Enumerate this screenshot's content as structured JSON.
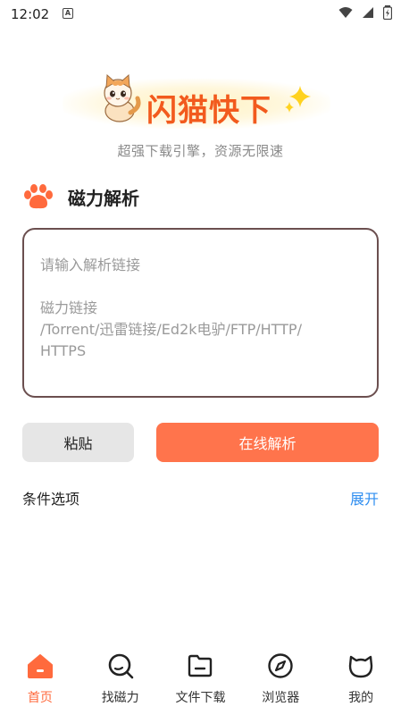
{
  "status_bar": {
    "time": "12:02",
    "notification_letter": "A"
  },
  "app": {
    "logo_title": "闪猫快下",
    "tagline": "超强下载引擎，资源无限速"
  },
  "section": {
    "title": "磁力解析"
  },
  "input": {
    "placeholder": "请输入解析链接",
    "hint_line1": "磁力链接",
    "hint_line2": "/Torrent/迅雷链接/Ed2k电驴/FTP/HTTP/",
    "hint_line3": "HTTPS"
  },
  "actions": {
    "paste_label": "粘贴",
    "parse_label": "在线解析"
  },
  "options": {
    "label": "条件选项",
    "expand_label": "展开"
  },
  "nav": {
    "items": [
      {
        "label": "首页",
        "icon": "home-icon",
        "active": true
      },
      {
        "label": "找磁力",
        "icon": "search-icon",
        "active": false
      },
      {
        "label": "文件下载",
        "icon": "folder-icon",
        "active": false
      },
      {
        "label": "浏览器",
        "icon": "compass-icon",
        "active": false
      },
      {
        "label": "我的",
        "icon": "cat-face-icon",
        "active": false
      }
    ]
  },
  "colors": {
    "accent": "#ff744c",
    "brand_title": "#f25a1d",
    "link": "#2f8ef0",
    "input_border": "#6b4f4f"
  }
}
